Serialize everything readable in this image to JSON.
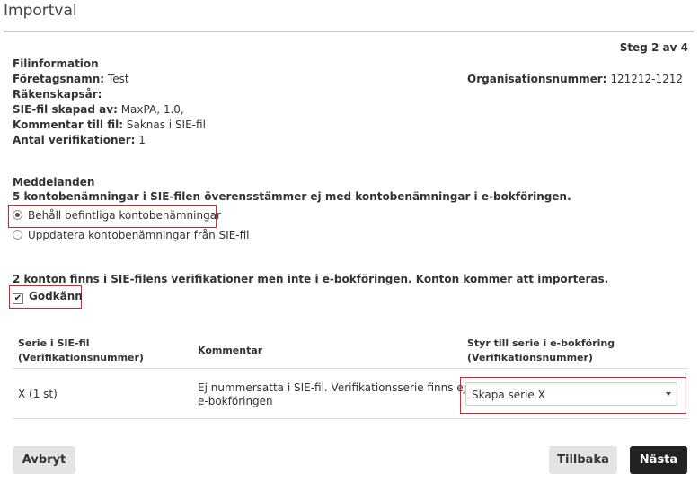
{
  "page": {
    "title": "Importval",
    "step": "Steg 2 av 4"
  },
  "file_info": {
    "heading": "Filinformation",
    "company_label": "Företagsnamn:",
    "company_value": "Test",
    "fiscal_year_label": "Räkenskapsår:",
    "created_by_label": "SIE-fil skapad av:",
    "created_by_value": "MaxPA, 1.0,",
    "comment_label": "Kommentar till fil:",
    "comment_value": "Saknas i SIE-fil",
    "verifications_label": "Antal verifikationer:",
    "verifications_value": "1",
    "org_number_label": "Organisationsnummer:",
    "org_number_value": "121212-1212"
  },
  "messages": {
    "heading": "Meddelanden",
    "account_names_notice": "5 kontobenämningar i SIE-filen överensstämmer ej med kontobenämningar i e-bokföringen.",
    "option_keep": "Behåll befintliga kontobenämningar",
    "option_update": "Uppdatera kontobenämningar från SIE-fil",
    "selected_option": "keep",
    "accounts_notice": "2 konton finns i SIE-filens verifikationer men inte i e-bokföringen. Konton kommer att importeras.",
    "approve_label": "Godkänn",
    "approve_checked": true
  },
  "series_table": {
    "headers": {
      "col1_line1": "Serie i SIE-fil",
      "col1_line2": "(Verifikationsnummer)",
      "col2": "Kommentar",
      "col3_line1": "Styr till serie i e-bokföring",
      "col3_line2": "(Verifikationsnummer)"
    },
    "rows": [
      {
        "series": "X (1 st)",
        "comment_line1": "Ej nummersatta i SIE-fil. Verifikationsserie finns ej i",
        "comment_line2": "e-bokföringen",
        "target": "Skapa serie X"
      }
    ]
  },
  "buttons": {
    "cancel": "Avbryt",
    "back": "Tillbaka",
    "next": "Nästa"
  },
  "colors": {
    "highlight": "#d9232d",
    "primary_button": "#222222",
    "secondary_button": "#e4e4e4"
  }
}
